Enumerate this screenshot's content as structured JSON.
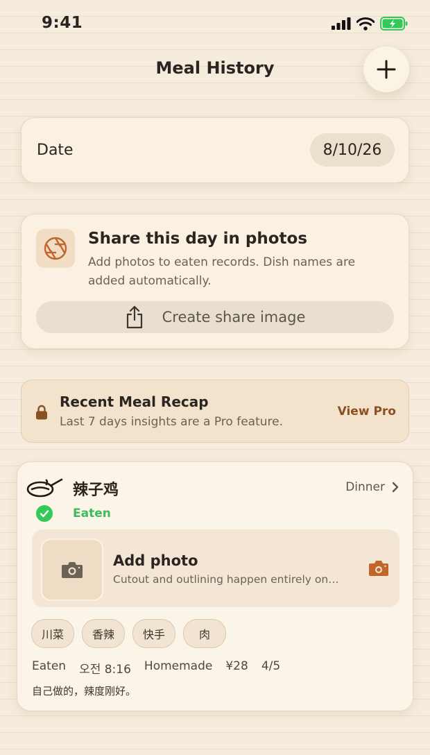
{
  "status_bar": {
    "time": "9:41"
  },
  "nav": {
    "title": "Meal History",
    "add_icon": "plus-icon"
  },
  "date_card": {
    "label": "Date",
    "value": "8/10/26"
  },
  "share_card": {
    "title": "Share this day in photos",
    "description": "Add photos to eaten records. Dish names are added automatically.",
    "button_label": "Create share image",
    "icon": "aperture-icon",
    "accent": "#c0652c"
  },
  "recap_card": {
    "title": "Recent Meal Recap",
    "subtitle": "Last 7 days insights are a Pro feature.",
    "link": "View Pro",
    "icon": "lock-icon"
  },
  "meal": {
    "name": "辣子鸡",
    "meal_type": "Dinner",
    "status": "Eaten",
    "status_color": "#34c759",
    "photo": {
      "title": "Add photo",
      "subtitle": "Cutout and outlining happen entirely on…"
    },
    "tags": [
      "川菜",
      "香辣",
      "快手",
      "肉"
    ],
    "meta": {
      "status": "Eaten",
      "time": "오전 8:16",
      "source": "Homemade",
      "price": "¥28",
      "rating": "4/5"
    },
    "note": "自己做的，辣度刚好。"
  }
}
